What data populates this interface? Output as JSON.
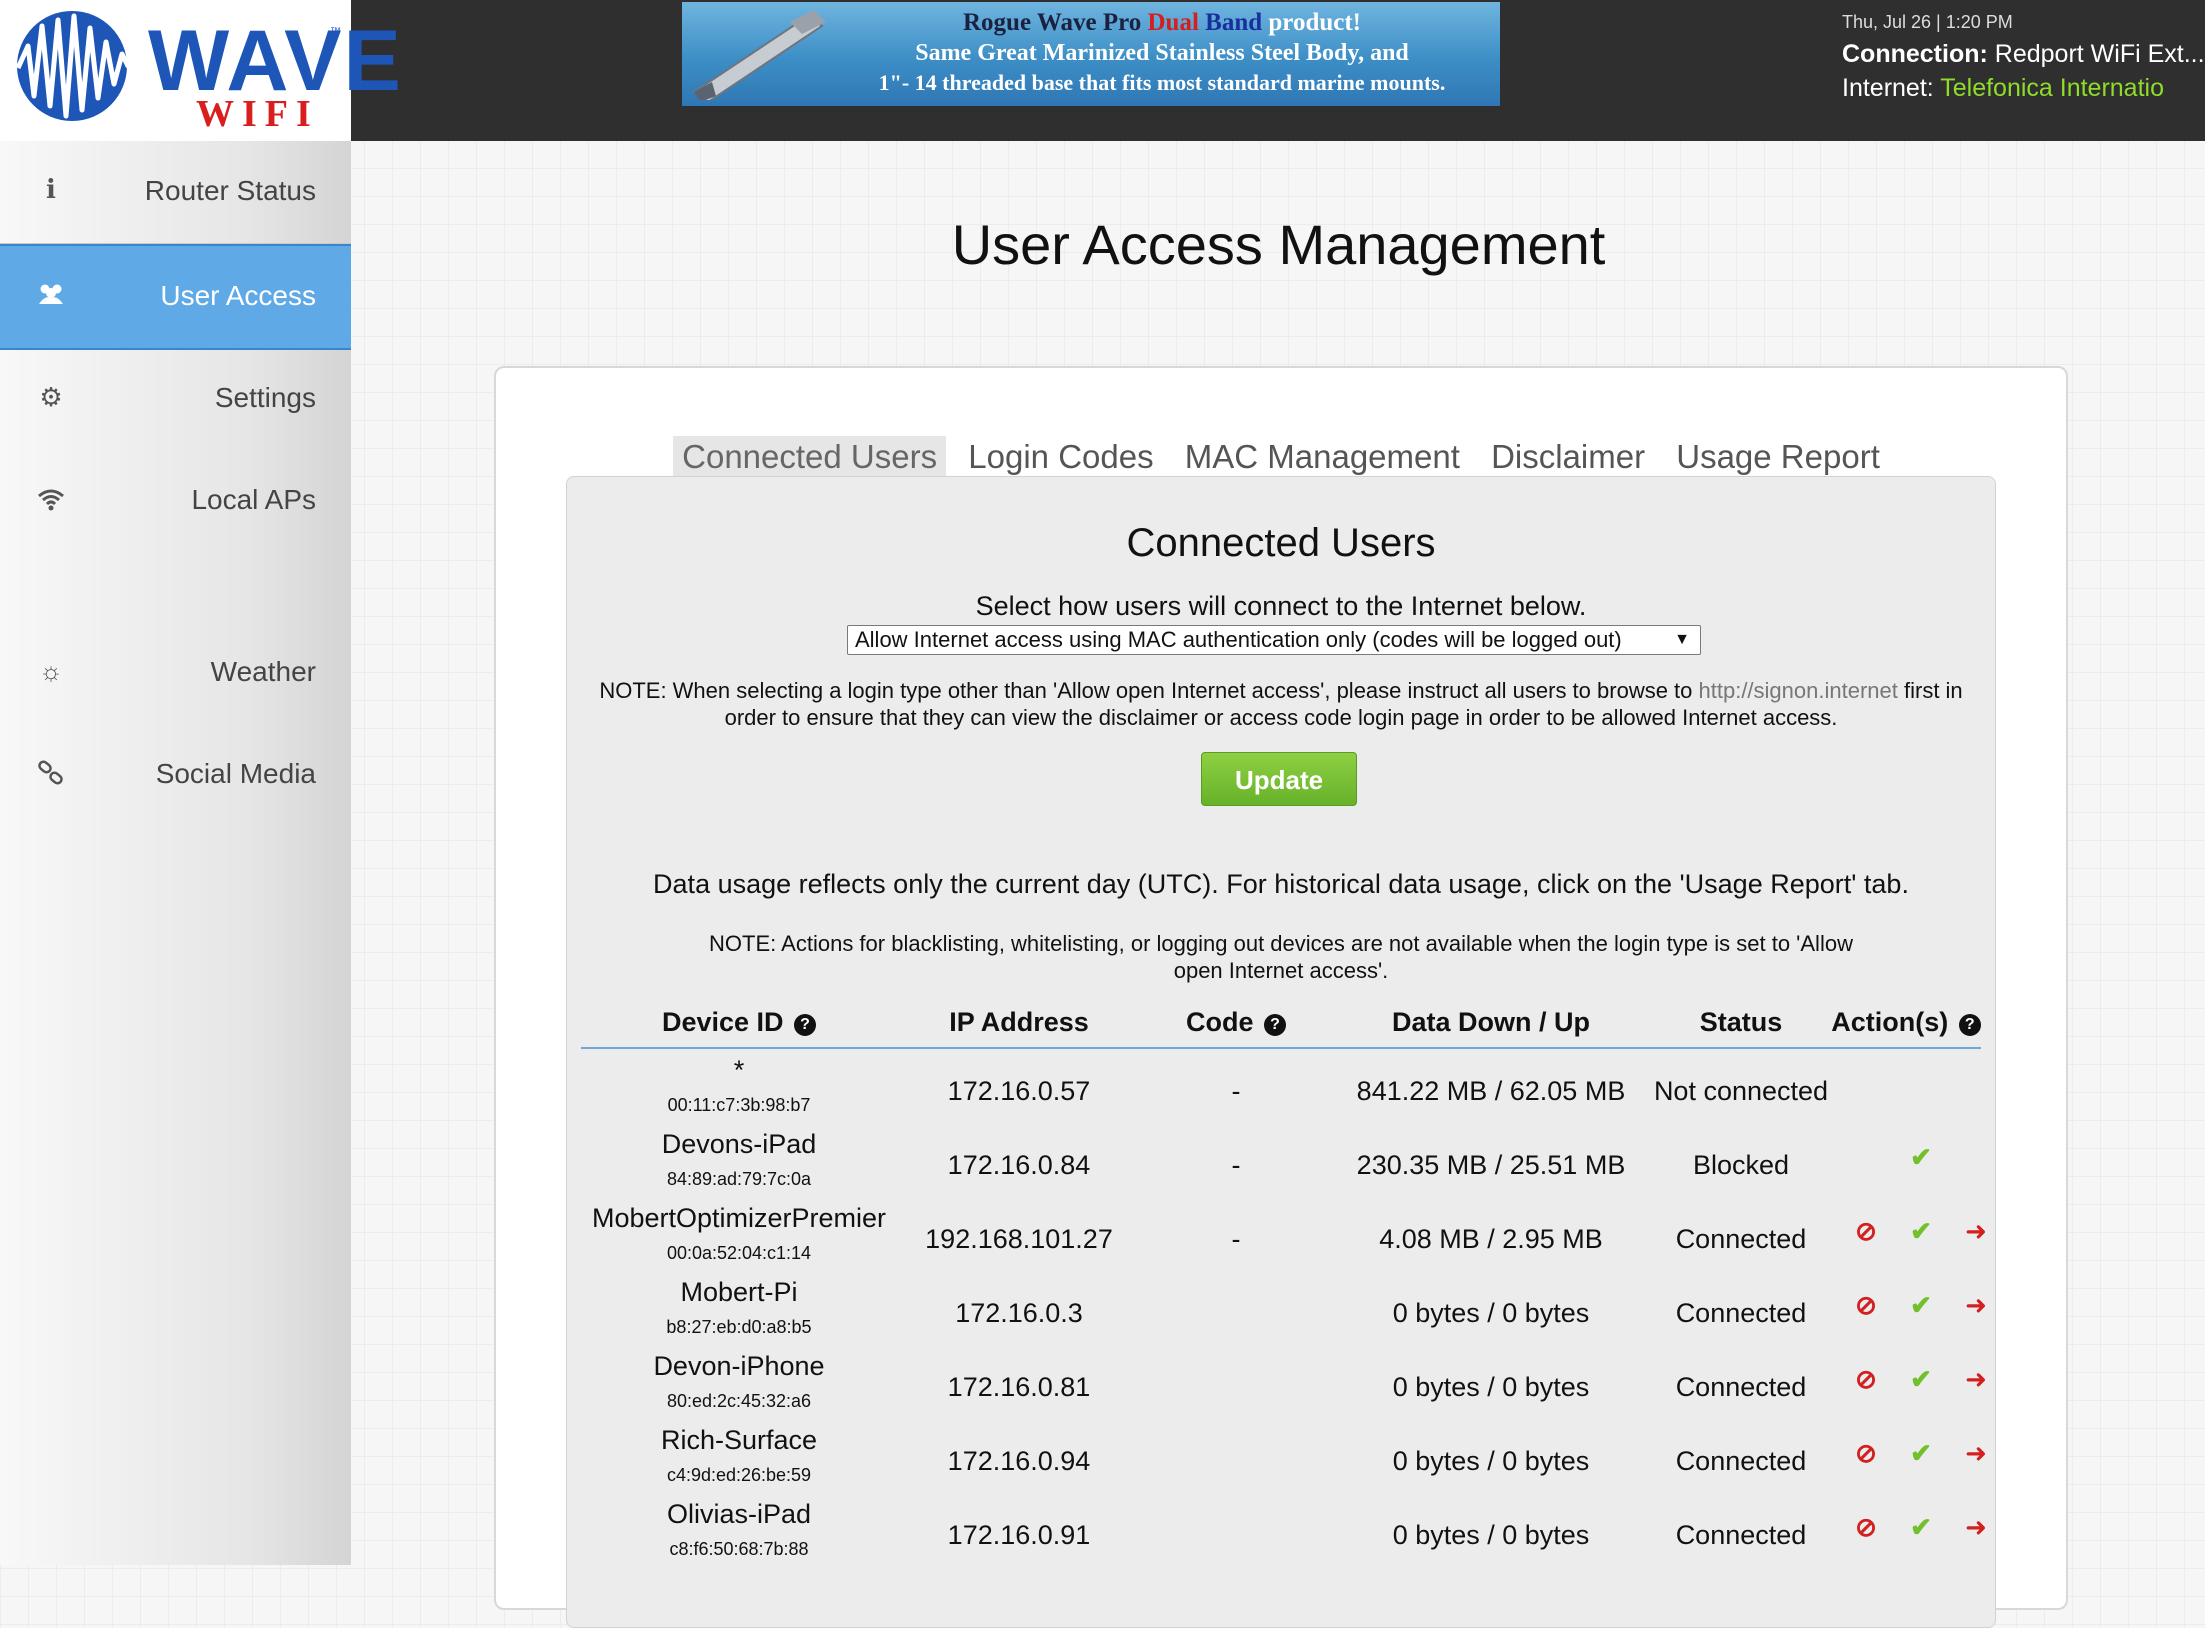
{
  "header": {
    "logo_text": "WAVE",
    "logo_sub": "WIFI",
    "logo_tm": "™",
    "ad": {
      "line1_a": "Rogue Wave Pro ",
      "line1_red": "Dual",
      "line1_blue": "Band",
      "line1_b": " product!",
      "line2": "Same Great Marinized Stainless Steel Body, and",
      "line3": "1\"- 14 threaded base that fits most standard marine mounts."
    },
    "datetime": "Thu, Jul 26 | 1:20 PM",
    "connection_label": "Connection:",
    "connection_value": "Redport WiFi Ext...",
    "internet_label": "Internet:",
    "internet_value": "Telefonica Internatio",
    "internet_color": "#8fdc2a"
  },
  "sidebar": {
    "items": [
      {
        "label": "Router Status",
        "icon": "info-icon"
      },
      {
        "label": "User Access",
        "icon": "users-icon",
        "active": true
      },
      {
        "label": "Settings",
        "icon": "gears-icon"
      },
      {
        "label": "Local APs",
        "icon": "wifi-icon"
      },
      {
        "label": "Weather",
        "icon": "sun-icon"
      },
      {
        "label": "Social Media",
        "icon": "link-icon"
      }
    ],
    "active_color": "#5ea9e6"
  },
  "main": {
    "title": "User Access Management",
    "tabs": [
      {
        "label": "Connected Users",
        "active": true
      },
      {
        "label": "Login Codes"
      },
      {
        "label": "MAC Management"
      },
      {
        "label": "Disclaimer"
      },
      {
        "label": "Usage Report"
      }
    ],
    "panel": {
      "title": "Connected Users",
      "select_label": "Select how users will connect to the Internet below.",
      "select_value": "Allow Internet access using MAC authentication only (codes will be logged out)",
      "note1_a": "NOTE: When selecting a login type other than 'Allow open Internet access', please instruct all users to browse to ",
      "note1_link": "http://signon.internet",
      "note1_b": " first in order to ensure that they can view the disclaimer or access code login page in order to be allowed Internet access.",
      "update_label": "Update",
      "update_color": "#72b92f",
      "usage_note": "Data usage reflects only the current day (UTC). For historical data usage, click on the 'Usage Report' tab.",
      "note2": "NOTE: Actions for blacklisting, whitelisting, or logging out devices are not available when the login type is set to 'Allow open Internet access'."
    },
    "table": {
      "headers": {
        "device_id": "Device ID",
        "ip": "IP Address",
        "code": "Code",
        "data": "Data Down / Up",
        "status": "Status",
        "actions": "Action(s)"
      },
      "rows": [
        {
          "name": "*",
          "mac": "00:11:c7:3b:98:b7",
          "ip": "172.16.0.57",
          "code": "-",
          "data": "841.22 MB / 62.05 MB",
          "status": "Not connected",
          "actions": []
        },
        {
          "name": "Devons-iPad",
          "mac": "84:89:ad:79:7c:0a",
          "ip": "172.16.0.84",
          "code": "-",
          "data": "230.35 MB / 25.51 MB",
          "status": "Blocked",
          "actions": [
            "allow"
          ]
        },
        {
          "name": "MobertOptimizerPremier",
          "mac": "00:0a:52:04:c1:14",
          "ip": "192.168.101.27",
          "code": "-",
          "data": "4.08 MB / 2.95 MB",
          "status": "Connected",
          "actions": [
            "block",
            "allow",
            "logout"
          ]
        },
        {
          "name": "Mobert-Pi",
          "mac": "b8:27:eb:d0:a8:b5",
          "ip": "172.16.0.3",
          "code": "",
          "data": "0 bytes / 0 bytes",
          "status": "Connected",
          "actions": [
            "block",
            "allow",
            "logout"
          ]
        },
        {
          "name": "Devon-iPhone",
          "mac": "80:ed:2c:45:32:a6",
          "ip": "172.16.0.81",
          "code": "",
          "data": "0 bytes / 0 bytes",
          "status": "Connected",
          "actions": [
            "block",
            "allow",
            "logout"
          ]
        },
        {
          "name": "Rich-Surface",
          "mac": "c4:9d:ed:26:be:59",
          "ip": "172.16.0.94",
          "code": "",
          "data": "0 bytes / 0 bytes",
          "status": "Connected",
          "actions": [
            "block",
            "allow",
            "logout"
          ]
        },
        {
          "name": "Olivias-iPad",
          "mac": "c8:f6:50:68:7b:88",
          "ip": "172.16.0.91",
          "code": "",
          "data": "0 bytes / 0 bytes",
          "status": "Connected",
          "actions": [
            "block",
            "allow",
            "logout"
          ]
        }
      ]
    }
  }
}
